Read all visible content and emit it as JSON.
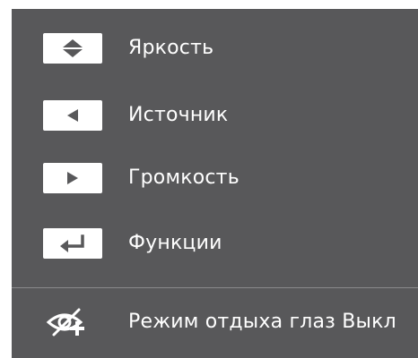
{
  "menu": {
    "items": [
      {
        "icon": "up-down-arrows-icon",
        "label": "Яркость"
      },
      {
        "icon": "left-arrow-icon",
        "label": "Источник"
      },
      {
        "icon": "right-arrow-icon",
        "label": "Громкость"
      },
      {
        "icon": "enter-return-icon",
        "label": "Функции"
      }
    ],
    "eye_saver": {
      "icon": "eye-saver-icon",
      "label": "Режим отдыха глаз Выкл"
    }
  },
  "colors": {
    "panel_background": "#58585a",
    "key_background": "#ffffff",
    "icon_color": "#58585a",
    "text_color": "#ffffff"
  }
}
